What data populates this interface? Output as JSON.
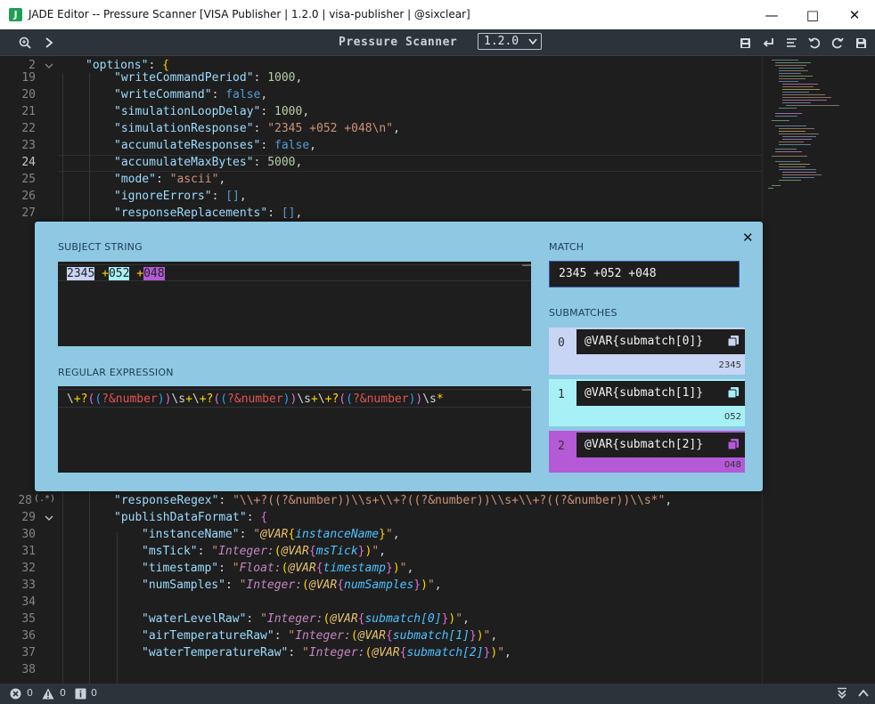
{
  "window": {
    "title": "JADE Editor -- Pressure Scanner [VISA Publisher | 1.2.0 | visa-publisher | @sixclear]",
    "app_icon_letter": "J"
  },
  "toolbar": {
    "doc_title": "Pressure Scanner",
    "version": "1.2.0"
  },
  "editor": {
    "lines_top": [
      {
        "n": "2",
        "code": "options"
      },
      {
        "n": "19",
        "key": "writeCommandPeriod",
        "val": "1000"
      },
      {
        "n": "20",
        "key": "writeCommand",
        "val": "false"
      },
      {
        "n": "21",
        "key": "simulationLoopDelay",
        "val": "1000"
      },
      {
        "n": "22",
        "key": "simulationResponse",
        "val": "\"2345 +052 +048\\n\""
      },
      {
        "n": "23",
        "key": "accumulateResponses",
        "val": "false"
      },
      {
        "n": "24",
        "key": "accumulateMaxBytes",
        "val": "5000"
      },
      {
        "n": "25",
        "key": "mode",
        "val": "\"ascii\""
      },
      {
        "n": "26",
        "key": "ignoreErrors",
        "val": "[]"
      },
      {
        "n": "27",
        "key": "responseReplacements",
        "val": "[]"
      }
    ],
    "lines_bottom": [
      {
        "n": "28",
        "key": "responseRegex",
        "val": "\"\\\\+?((?&number))\\\\s+\\\\+?((?&number))\\\\s+\\\\+?((?&number))\\\\s*\""
      },
      {
        "n": "29",
        "key": "publishDataFormat"
      },
      {
        "n": "30",
        "key": "instanceName"
      },
      {
        "n": "31",
        "key": "msTick"
      },
      {
        "n": "32",
        "key": "timestamp"
      },
      {
        "n": "33",
        "key": "numSamples"
      },
      {
        "n": "34"
      },
      {
        "n": "35",
        "key": "waterLevelRaw"
      },
      {
        "n": "36",
        "key": "airTemperatureRaw"
      },
      {
        "n": "37",
        "key": "waterTemperatureRaw"
      },
      {
        "n": "38"
      }
    ],
    "regex_marker": "(.*)"
  },
  "regex_popup": {
    "subject_label": "SUBJECT STRING",
    "subject_parts": [
      "2345",
      " ",
      "+",
      "052",
      " ",
      "+",
      "048"
    ],
    "regex_label": "REGULAR EXPRESSION",
    "match_label": "MATCH",
    "match_value": "2345 +052 +048",
    "submatches_label": "SUBMATCHES",
    "submatches": [
      {
        "index": "0",
        "var": "@VAR{submatch[0]}",
        "value": "2345",
        "color": "#c9d5f5"
      },
      {
        "index": "1",
        "var": "@VAR{submatch[1]}",
        "value": "052",
        "color": "#a7f1f6"
      },
      {
        "index": "2",
        "var": "@VAR{submatch[2]}",
        "value": "048",
        "color": "#b45ad6"
      }
    ],
    "close_glyph": "✕"
  },
  "status": {
    "errors": "0",
    "warnings": "0",
    "info": "0"
  },
  "colors": {
    "popup_bg": "#8ec8e2",
    "editor_bg": "#1e1e1e",
    "toolbar_bg": "#2d333b"
  }
}
